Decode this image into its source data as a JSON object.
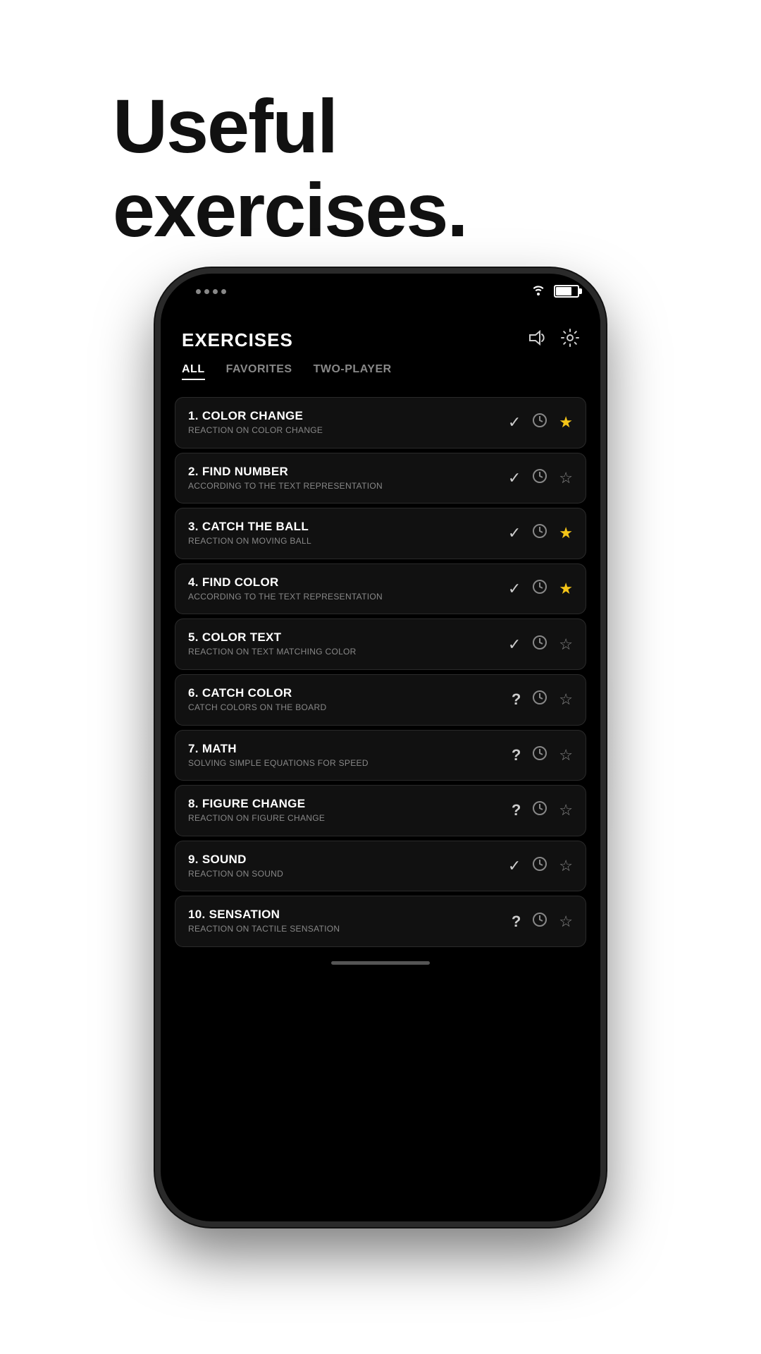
{
  "hero": {
    "title_line1": "Useful",
    "title_line2": "exercises."
  },
  "app": {
    "title": "EXERCISES",
    "sound_icon": "🔊",
    "settings_icon": "⚙"
  },
  "tabs": [
    {
      "label": "ALL",
      "active": true
    },
    {
      "label": "FAVORITES",
      "active": false
    },
    {
      "label": "TWO-PLAYER",
      "active": false
    }
  ],
  "exercises": [
    {
      "number": "1.",
      "name": "COLOR CHANGE",
      "description": "REACTION ON COLOR CHANGE",
      "status": "check",
      "favorited": true
    },
    {
      "number": "2.",
      "name": "FIND NUMBER",
      "description": "ACCORDING TO THE TEXT REPRESENTATION",
      "status": "check",
      "favorited": false
    },
    {
      "number": "3.",
      "name": "CATCH THE BALL",
      "description": "REACTION ON MOVING BALL",
      "status": "check",
      "favorited": true
    },
    {
      "number": "4.",
      "name": "FIND COLOR",
      "description": "ACCORDING TO THE TEXT REPRESENTATION",
      "status": "check",
      "favorited": true
    },
    {
      "number": "5.",
      "name": "COLOR TEXT",
      "description": "REACTION ON TEXT MATCHING COLOR",
      "status": "check",
      "favorited": false
    },
    {
      "number": "6.",
      "name": "CATCH COLOR",
      "description": "CATCH COLORS ON THE BOARD",
      "status": "question",
      "favorited": false
    },
    {
      "number": "7.",
      "name": "MATH",
      "description": "SOLVING SIMPLE EQUATIONS FOR SPEED",
      "status": "question",
      "favorited": false
    },
    {
      "number": "8.",
      "name": "FIGURE CHANGE",
      "description": "REACTION ON FIGURE CHANGE",
      "status": "question",
      "favorited": false
    },
    {
      "number": "9.",
      "name": "SOUND",
      "description": "REACTION ON SOUND",
      "status": "check",
      "favorited": false
    },
    {
      "number": "10.",
      "name": "SENSATION",
      "description": "REACTION ON TACTILE SENSATION",
      "status": "question",
      "favorited": false
    }
  ],
  "colors": {
    "accent_gold": "#f5c518",
    "bg_dark": "#000000",
    "bg_card": "#111111",
    "text_primary": "#ffffff",
    "text_secondary": "#888888"
  }
}
